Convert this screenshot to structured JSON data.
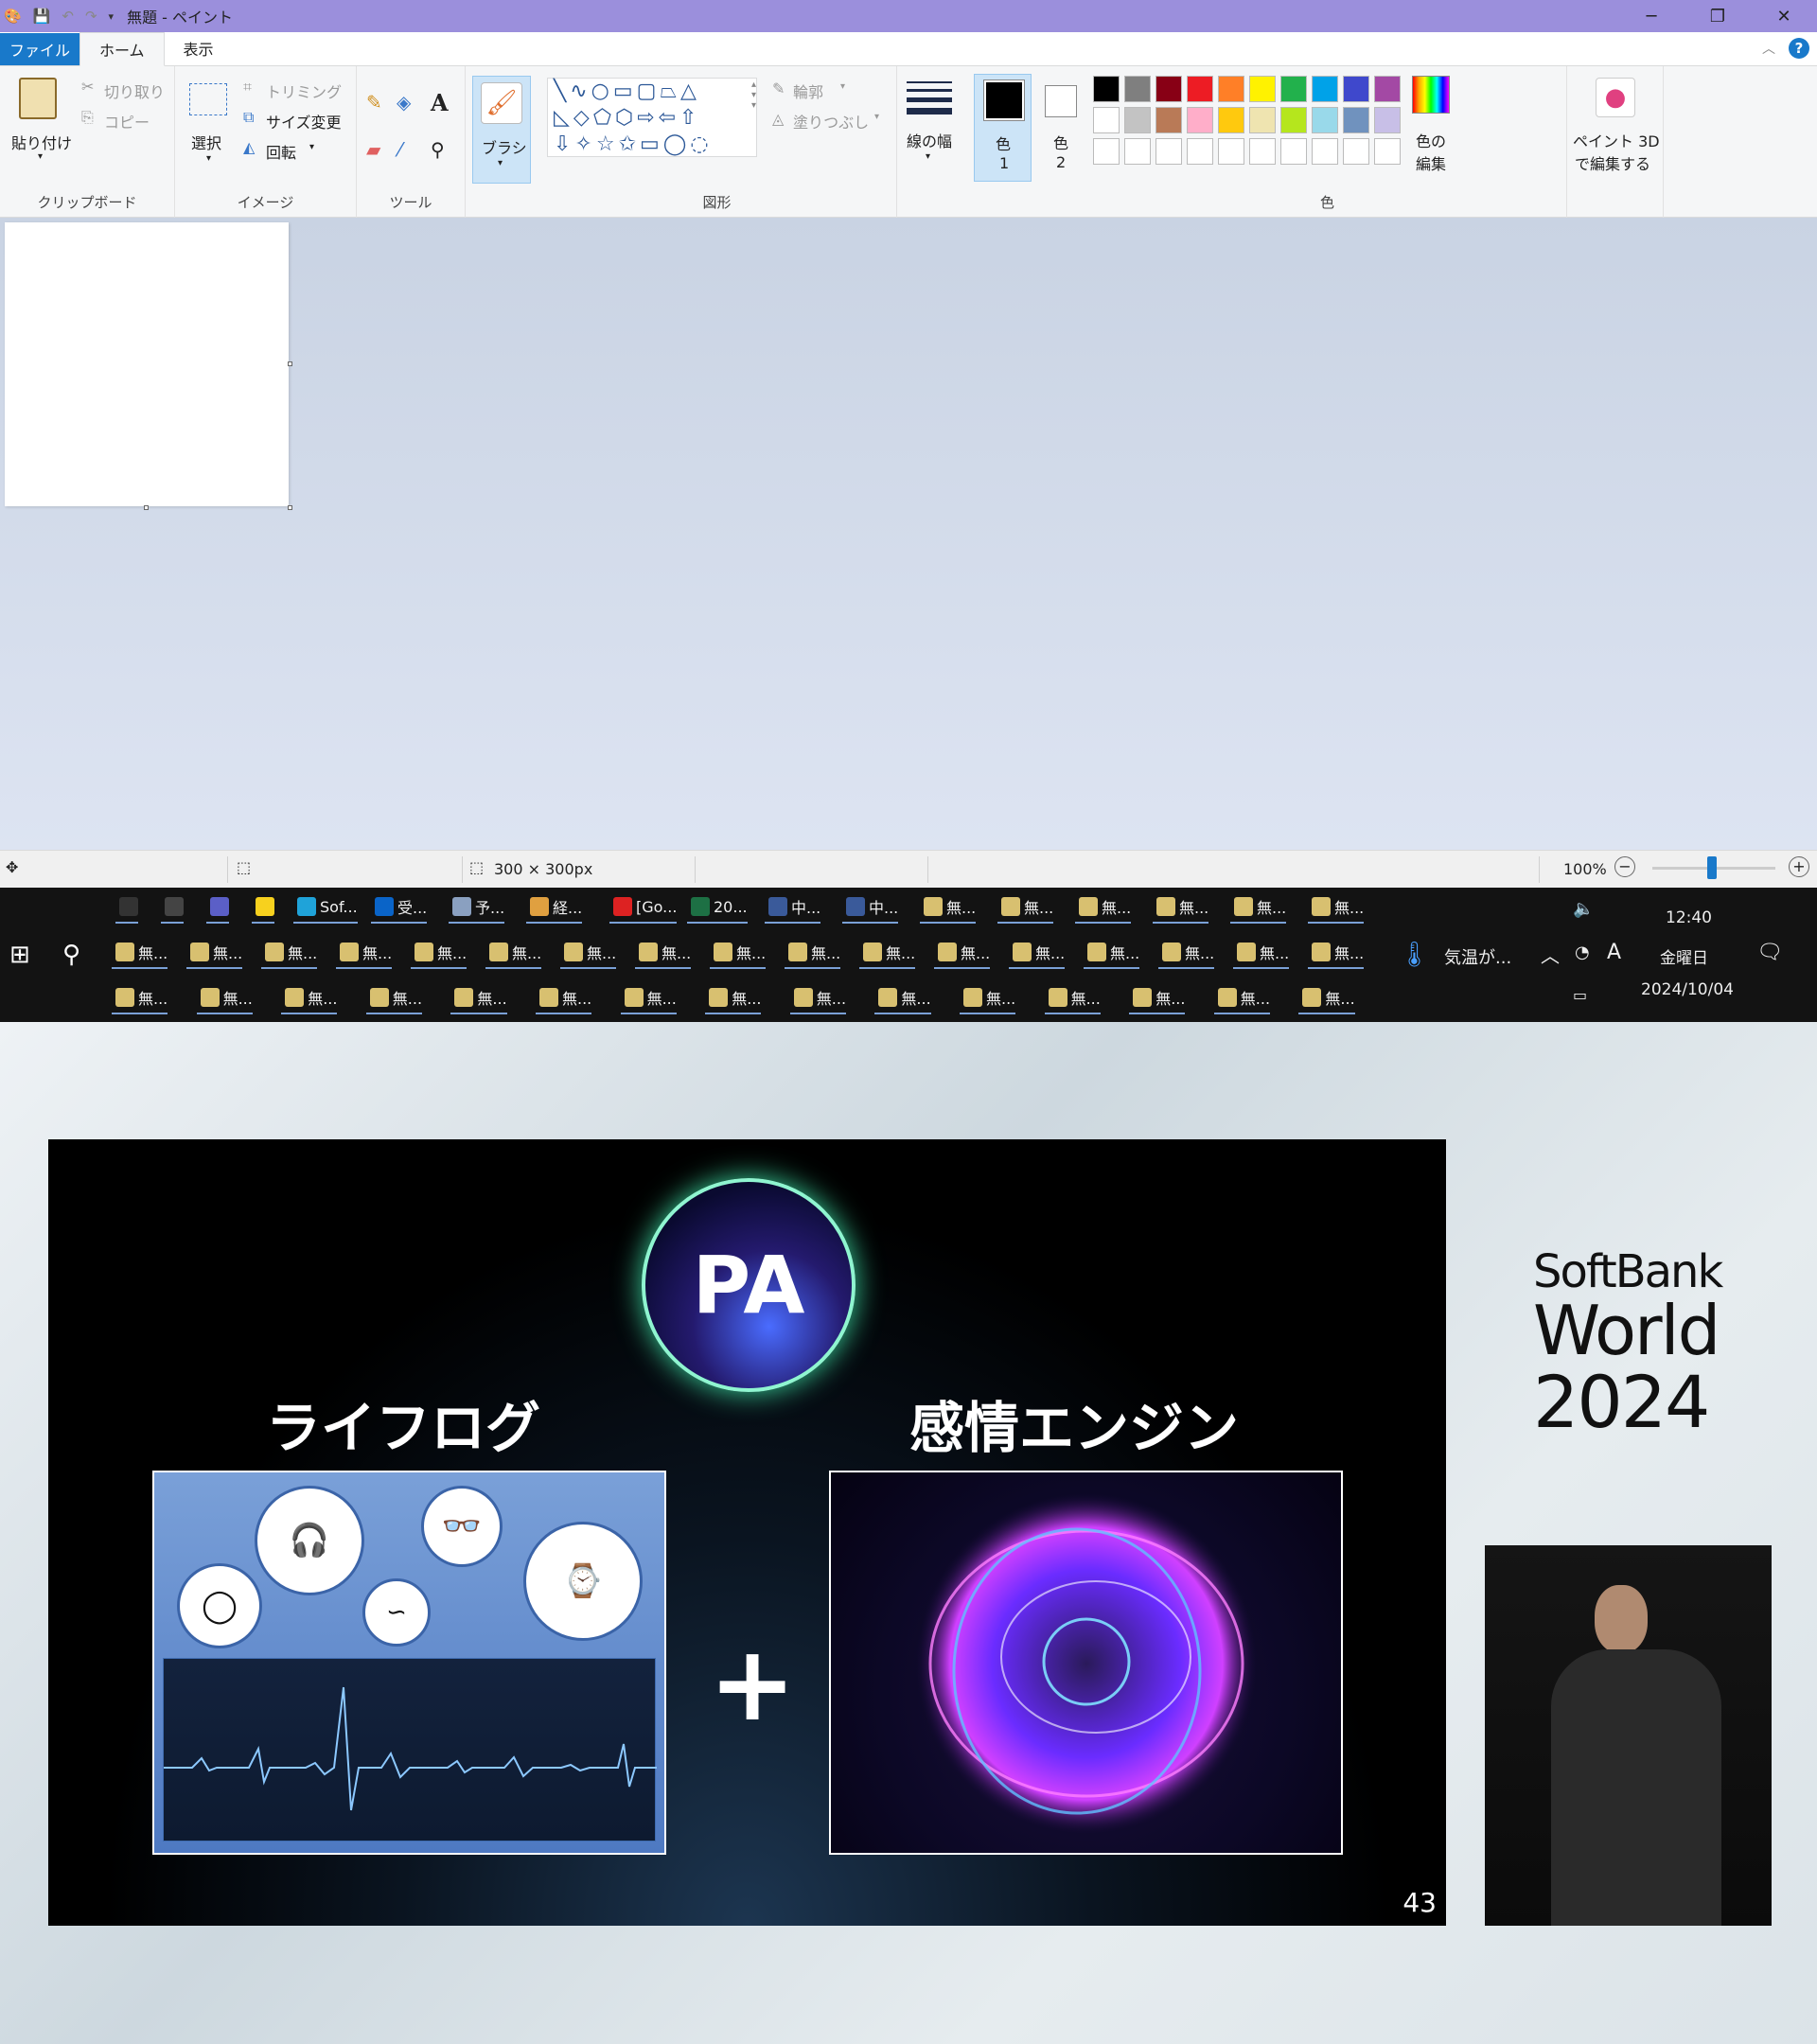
{
  "paint": {
    "title": "無題 - ペイント",
    "window_controls": {
      "minimize": "─",
      "restore": "❐",
      "close": "✕"
    },
    "tabs": {
      "file": "ファイル",
      "home": "ホーム",
      "view": "表示"
    },
    "clipboard": {
      "paste": "貼り付け",
      "cut": "切り取り",
      "copy": "コピー",
      "group": "クリップボード"
    },
    "image": {
      "select": "選択",
      "crop": "トリミング",
      "resize": "サイズ変更",
      "rotate": "回転",
      "group": "イメージ"
    },
    "tools": {
      "group": "ツール"
    },
    "brush": {
      "label": "ブラシ"
    },
    "shapes": {
      "outline": "輪郭",
      "fill": "塗りつぶし",
      "group": "図形"
    },
    "line_width": {
      "label": "線の幅"
    },
    "color1": {
      "label_a": "色",
      "label_b": "1"
    },
    "color2": {
      "label_a": "色",
      "label_b": "2"
    },
    "colors": {
      "group": "色",
      "edit_a": "色の",
      "edit_b": "編集",
      "palette_row1": [
        "#000000",
        "#7f7f7f",
        "#880015",
        "#ed1c24",
        "#ff7f27",
        "#fff200",
        "#22b14c",
        "#00a2e8",
        "#3f48cc",
        "#a349a4"
      ],
      "palette_row2": [
        "#ffffff",
        "#c3c3c3",
        "#b97a57",
        "#ffaec9",
        "#ffc90e",
        "#efe4b0",
        "#b5e61d",
        "#99d9ea",
        "#7092be",
        "#c8bfe7"
      ],
      "palette_row3": [
        "#ffffff",
        "#ffffff",
        "#ffffff",
        "#ffffff",
        "#ffffff",
        "#ffffff",
        "#ffffff",
        "#ffffff",
        "#ffffff",
        "#ffffff"
      ]
    },
    "paint3d": {
      "line1": "ペイント 3D",
      "line2": "で編集する"
    },
    "status": {
      "canvas_size": "300 × 300px",
      "zoom": "100%"
    }
  },
  "taskbar": {
    "row1": [
      {
        "label": "",
        "icon": "terminal-icon",
        "color": "#333"
      },
      {
        "label": "",
        "icon": "window-icon",
        "color": "#444"
      },
      {
        "label": "",
        "icon": "teams-icon",
        "color": "#5b5fc7"
      },
      {
        "label": "",
        "icon": "sticky-notes-icon",
        "color": "#f7d11e"
      },
      {
        "label": "Sof...",
        "icon": "edge-icon",
        "color": "#1fa3d9"
      },
      {
        "label": "受...",
        "icon": "outlook-icon",
        "color": "#0a64c8"
      },
      {
        "label": "予...",
        "icon": "calendar-icon",
        "color": "#8aa0c0"
      },
      {
        "label": "経...",
        "icon": "mail-icon",
        "color": "#e0a040"
      },
      {
        "label": "[Go...",
        "icon": "pdf-icon",
        "color": "#d22"
      },
      {
        "label": "20...",
        "icon": "excel-icon",
        "color": "#1d7044"
      },
      {
        "label": "中...",
        "icon": "app-icon",
        "color": "#3a5a9a"
      },
      {
        "label": "中...",
        "icon": "app-icon",
        "color": "#3a5a9a"
      },
      {
        "label": "無...",
        "icon": "paint-icon",
        "color": "#d8c070"
      },
      {
        "label": "無...",
        "icon": "paint-icon",
        "color": "#d8c070"
      },
      {
        "label": "無...",
        "icon": "paint-icon",
        "color": "#d8c070"
      },
      {
        "label": "無...",
        "icon": "paint-icon",
        "color": "#d8c070"
      },
      {
        "label": "無...",
        "icon": "paint-icon",
        "color": "#d8c070"
      },
      {
        "label": "無...",
        "icon": "paint-icon",
        "color": "#d8c070"
      }
    ],
    "row2_label": "無...",
    "row3_label": "無...",
    "weather": "気温が...",
    "time": "12:40",
    "day": "金曜日",
    "date": "2024/10/04"
  },
  "slide": {
    "pa": "PA",
    "heading_left": "ライフログ",
    "heading_right": "感情エンジン",
    "plus": "+",
    "page_number": "43"
  },
  "brand": {
    "line1": "SoftBank",
    "line2": "World",
    "line3": "2024"
  }
}
